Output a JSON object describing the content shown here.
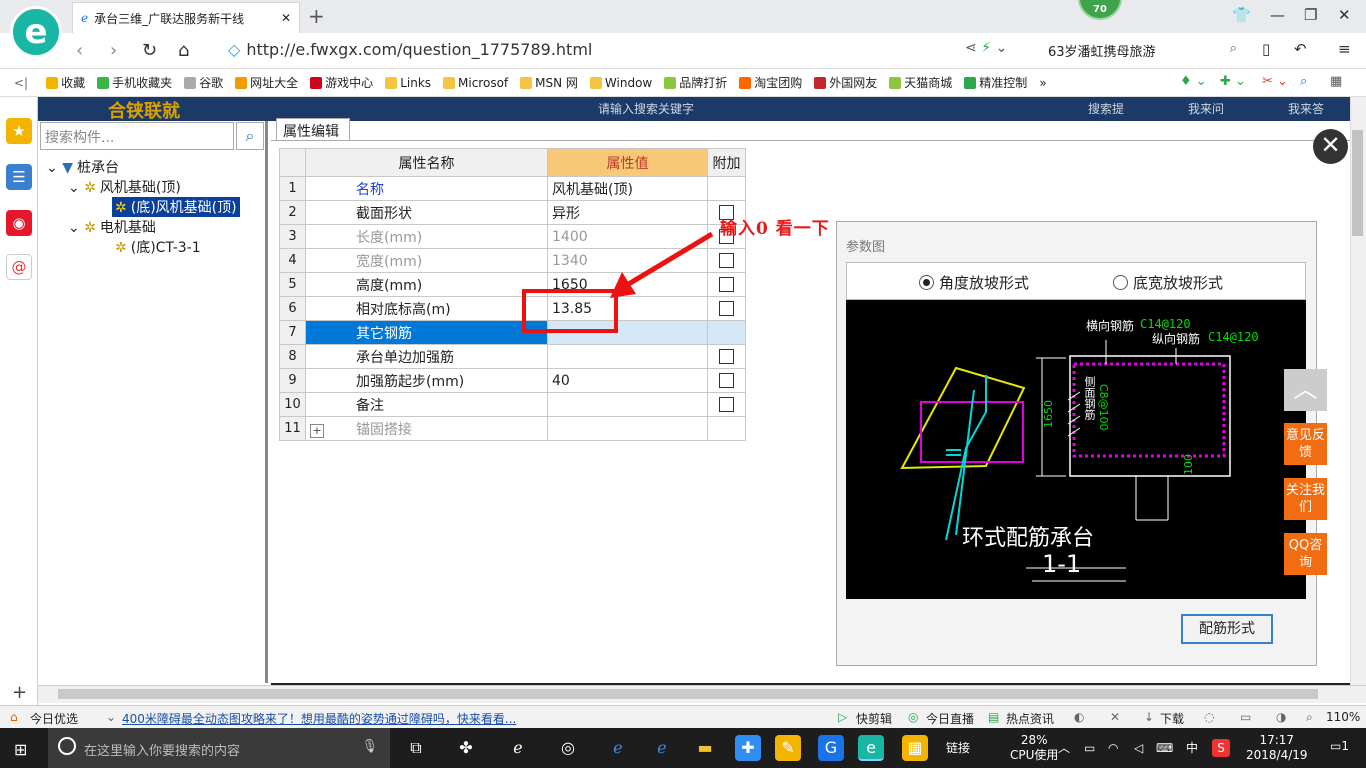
{
  "browser": {
    "tab_title": "承台三维_广联达服务新干线",
    "new_tab": "+",
    "badge": "70",
    "url": "http://e.fwxgx.com/question_1775789.html",
    "search_text": "63岁潘虹携母旅游",
    "bookmarks": [
      {
        "label": "收藏",
        "color": "#f2b400"
      },
      {
        "label": "手机收藏夹",
        "color": "#3ab54a"
      },
      {
        "label": "谷歌",
        "color": "#aaaaaa"
      },
      {
        "label": "网址大全",
        "color": "#f29b00"
      },
      {
        "label": "游戏中心",
        "color": "#d0021b"
      },
      {
        "label": "Links",
        "color": "#f5c542"
      },
      {
        "label": "Microsof",
        "color": "#f5c542"
      },
      {
        "label": "MSN 网",
        "color": "#f5c542"
      },
      {
        "label": "Window",
        "color": "#f5c542"
      },
      {
        "label": "品牌打折",
        "color": "#8cc63f"
      },
      {
        "label": "淘宝团购",
        "color": "#ff6600"
      },
      {
        "label": "外国网友",
        "color": "#c1272d"
      },
      {
        "label": "天猫商城",
        "color": "#8cc63f"
      },
      {
        "label": "精准控制",
        "color": "#2aa84a"
      }
    ],
    "more": "»"
  },
  "page_header": {
    "search_placeholder": "请输入搜索关键字",
    "search_btn": "搜索提",
    "ask_btn": "我来问",
    "answer_btn": "我来答",
    "banner": "合铗联就"
  },
  "tree": {
    "search_placeholder": "搜索构件...",
    "nodes": [
      {
        "label": "桩承台"
      },
      {
        "label": "风机基础(顶)"
      },
      {
        "label": "(底)风机基础(顶)"
      },
      {
        "label": "电机基础"
      },
      {
        "label": "(底)CT-3-1"
      }
    ]
  },
  "property_panel": {
    "tab": "属性编辑",
    "headers": {
      "name": "属性名称",
      "value": "属性值",
      "extra": "附加"
    },
    "rows": [
      {
        "n": "1",
        "name": "名称",
        "value": "风机基础(顶)",
        "cb": false
      },
      {
        "n": "2",
        "name": "截面形状",
        "value": "异形",
        "cb": true
      },
      {
        "n": "3",
        "name": "长度(mm)",
        "value": "1400",
        "cb": true
      },
      {
        "n": "4",
        "name": "宽度(mm)",
        "value": "1340",
        "cb": true
      },
      {
        "n": "5",
        "name": "高度(mm)",
        "value": "1650",
        "cb": true
      },
      {
        "n": "6",
        "name": "相对底标高(m)",
        "value": "13.85",
        "cb": true
      },
      {
        "n": "7",
        "name": "其它钢筋",
        "value": "",
        "cb": false
      },
      {
        "n": "8",
        "name": "承台单边加强筋",
        "value": "",
        "cb": true
      },
      {
        "n": "9",
        "name": "加强筋起步(mm)",
        "value": "40",
        "cb": true
      },
      {
        "n": "10",
        "name": "备注",
        "value": "",
        "cb": true
      },
      {
        "n": "11",
        "name": "锚固搭接",
        "value": "",
        "cb": false,
        "expander": "+"
      }
    ]
  },
  "annotation": "输入0  看一下",
  "diagram": {
    "title": "参数图",
    "option1": "角度放坡形式",
    "option2": "底宽放坡形式",
    "cad_labels": {
      "hbar": "横向钢筋",
      "hbar_val": "C14@120",
      "vbar": "纵向钢筋",
      "vbar_val": "C14@120",
      "side": "侧面钢筋",
      "side_val": "C8@100",
      "dim": "1650",
      "dim2": "100",
      "caption": "环式配筋承台",
      "section": "1-1"
    },
    "rebar_button": "配筋形式"
  },
  "float_buttons": {
    "top": "︿",
    "feedback": "意见反馈",
    "follow": "关注我们",
    "qq": "QQ咨询"
  },
  "statusbar": {
    "left": "今日优选",
    "news": "400米障碍最全动态图攻略来了！想用最酷的姿势通过障碍吗，快来看看...",
    "kuaijianji": "快剪辑",
    "zhibo": "今日直播",
    "redian": "热点资讯",
    "download": "下载",
    "zoom": "110%"
  },
  "taskbar": {
    "search_placeholder": "在这里输入你要搜索的内容",
    "links": "链接",
    "cpu_pct": "28%",
    "cpu_label": "CPU使用",
    "ime": "中",
    "time": "17:17",
    "date": "2018/4/19",
    "notif": "1"
  }
}
